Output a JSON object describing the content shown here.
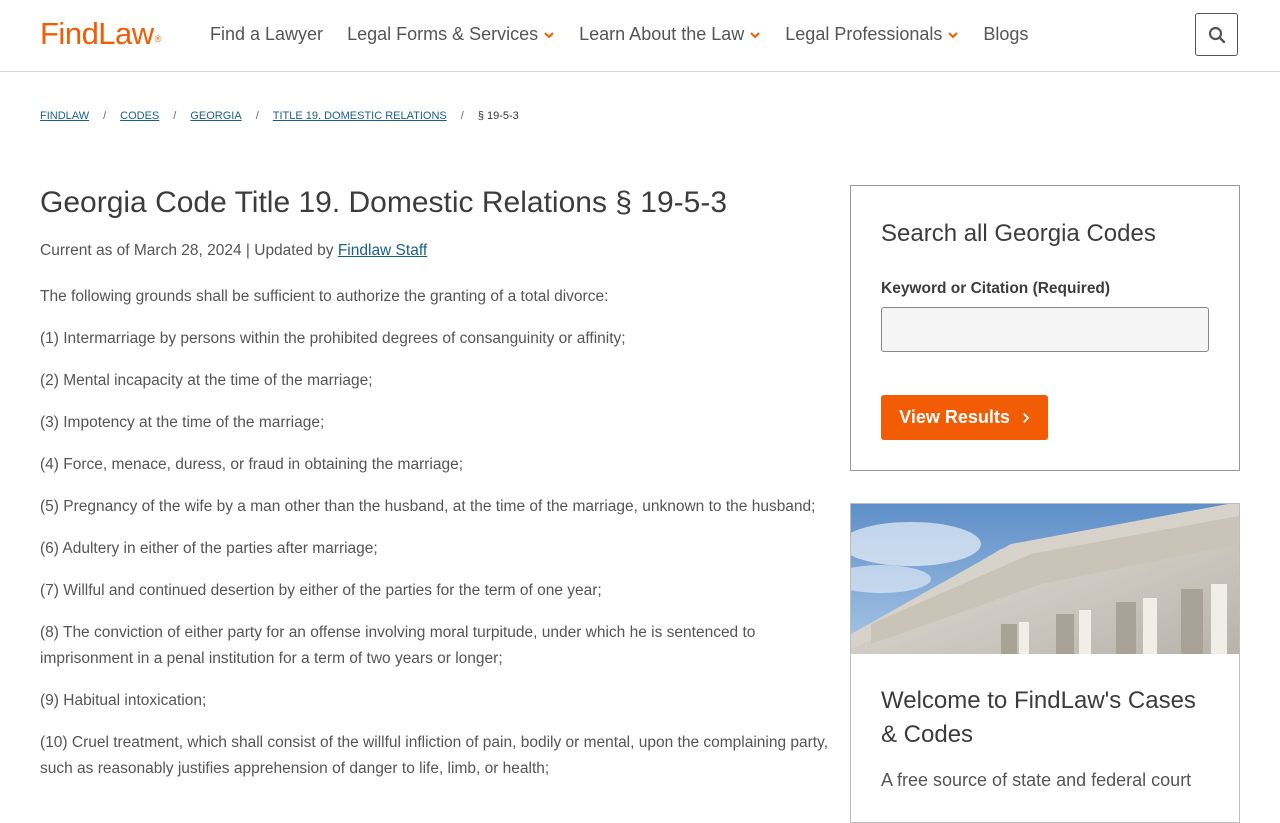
{
  "header": {
    "logo": "FindLaw",
    "logo_mark": "®",
    "nav": [
      {
        "label": "Find a Lawyer",
        "dropdown": false
      },
      {
        "label": "Legal Forms & Services",
        "dropdown": true
      },
      {
        "label": "Learn About the Law",
        "dropdown": true
      },
      {
        "label": "Legal Professionals",
        "dropdown": true
      },
      {
        "label": "Blogs",
        "dropdown": false
      }
    ],
    "search_icon": "search-icon"
  },
  "breadcrumb": {
    "items": [
      "FINDLAW",
      "CODES",
      "GEORGIA",
      "TITLE 19. DOMESTIC RELATIONS"
    ],
    "current": "§ 19-5-3",
    "separator": "/"
  },
  "article": {
    "title": "Georgia Code Title 19. Domestic Relations § 19-5-3",
    "meta_prefix": "Current as of March 28, 2024 | Updated by ",
    "meta_author": "Findlaw Staff",
    "paragraphs": [
      "The following grounds shall be sufficient to authorize the granting of a total divorce:",
      "(1) Intermarriage by persons within the prohibited degrees of consanguinity or affinity;",
      "(2) Mental incapacity at the time of the marriage;",
      "(3) Impotency at the time of the marriage;",
      "(4) Force, menace, duress, or fraud in obtaining the marriage;",
      "(5) Pregnancy of the wife by a man other than the husband, at the time of the marriage, unknown to the husband;",
      "(6) Adultery in either of the parties after marriage;",
      "(7) Willful and continued desertion by either of the parties for the term of one year;",
      "(8) The conviction of either party for an offense involving moral turpitude, under which he is sentenced to imprisonment in a penal institution for a term of two years or longer;",
      "(9) Habitual intoxication;",
      "(10) Cruel treatment, which shall consist of the willful infliction of pain, bodily or mental, upon the complaining party, such as reasonably justifies apprehension of danger to life, limb, or health;"
    ]
  },
  "sidebar": {
    "search": {
      "heading": "Search all Georgia Codes",
      "label": "Keyword or Citation (Required)",
      "input_value": "",
      "button": "View Results",
      "button_icon": "chevron-right-icon"
    },
    "welcome": {
      "heading": "Welcome to FindLaw's Cases & Codes",
      "text": "A free source of state and federal court"
    }
  },
  "colors": {
    "brand": "#f25c05",
    "link": "#1a5f8c",
    "text": "#555555"
  }
}
